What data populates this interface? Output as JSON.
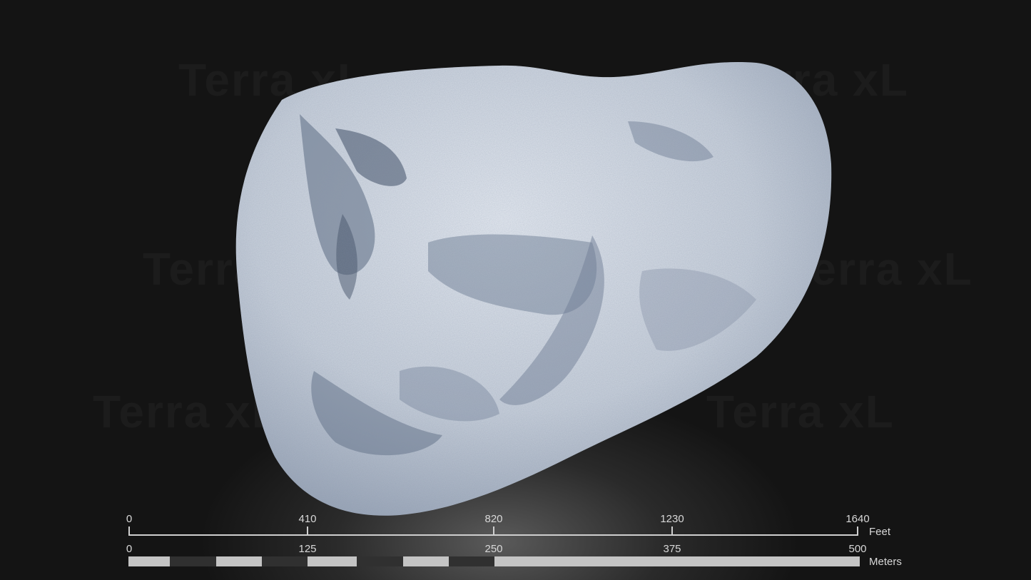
{
  "watermark": {
    "text": "Terra xL"
  },
  "terrain": {
    "icon": "terrain-relief-model"
  },
  "scale": {
    "feet": {
      "ticks": [
        "0",
        "410",
        "820",
        "1230",
        "1640"
      ],
      "unit": "Feet"
    },
    "meters": {
      "ticks": [
        "0",
        "125",
        "250",
        "375",
        "500"
      ],
      "unit": "Meters"
    },
    "colors": {
      "light": "#c4c4c4",
      "dark": "#303030",
      "line": "#cfcfcf"
    }
  }
}
